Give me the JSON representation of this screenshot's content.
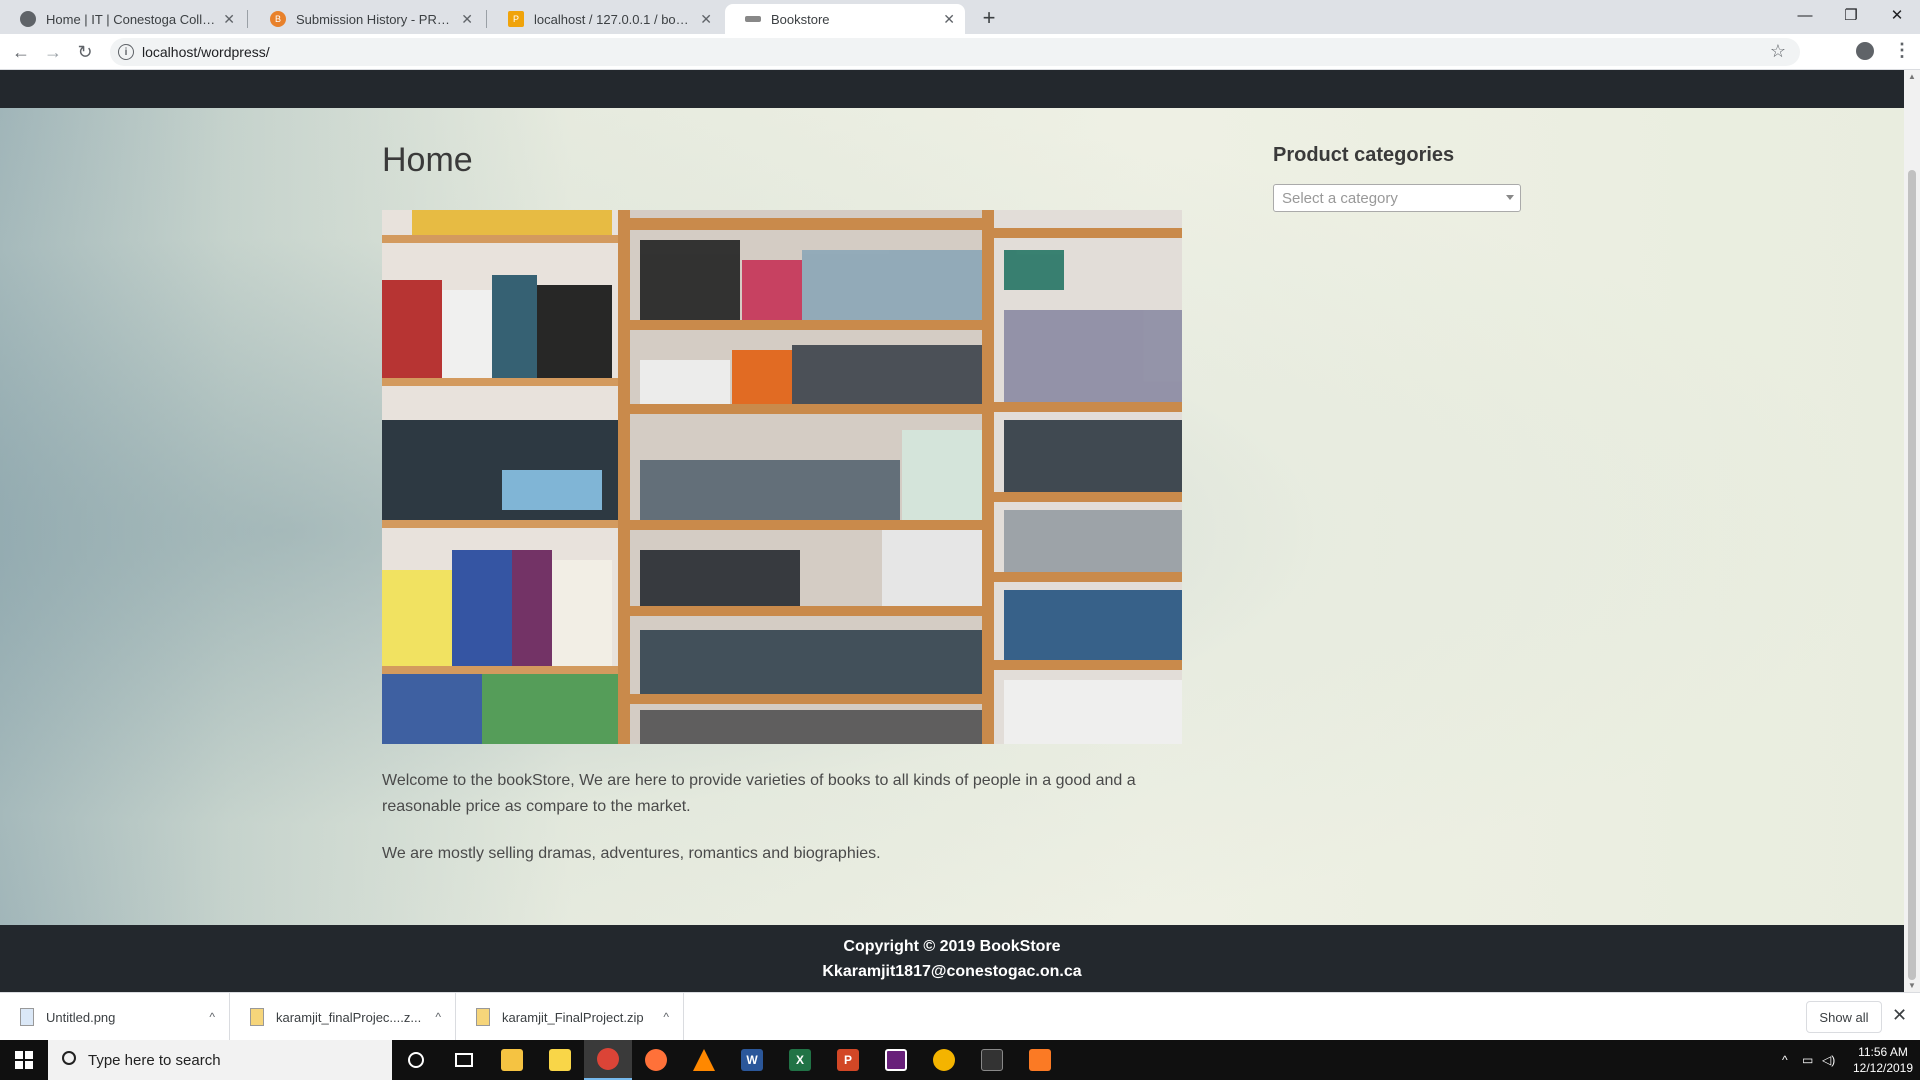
{
  "browser": {
    "tabs": [
      {
        "title": "Home | IT | Conestoga College",
        "favicon_color": "#5f6368"
      },
      {
        "title": "Submission History - PROG8370-",
        "favicon_color": "#e8812b"
      },
      {
        "title": "localhost / 127.0.0.1 / bookstore",
        "favicon_color": "#f0a30a"
      },
      {
        "title": "Bookstore",
        "favicon_color": "#888888"
      }
    ],
    "url": "localhost/wordpress/",
    "new_tab_symbol": "+"
  },
  "page": {
    "title": "Home",
    "hero_alt": "bookshelf-photo",
    "paragraphs": [
      "Welcome to the bookStore, We are here to provide varieties of books to all kinds of people in a good and a reasonable price as compare to the market.",
      "We are mostly selling dramas, adventures, romantics and biographies."
    ]
  },
  "sidebar": {
    "title": "Product categories",
    "select_placeholder": "Select a category"
  },
  "footer": {
    "copyright": "Copyright © 2019 BookStore",
    "email": "Kkaramjit1817@conestogac.on.ca"
  },
  "downloads": {
    "items": [
      {
        "name": "Untitled.png"
      },
      {
        "name": "karamjit_finalProjec....z..."
      },
      {
        "name": "karamjit_FinalProject.zip"
      }
    ],
    "show_all": "Show all"
  },
  "taskbar": {
    "search_placeholder": "Type here to search",
    "time": "11:56 AM",
    "date": "12/12/2019"
  }
}
